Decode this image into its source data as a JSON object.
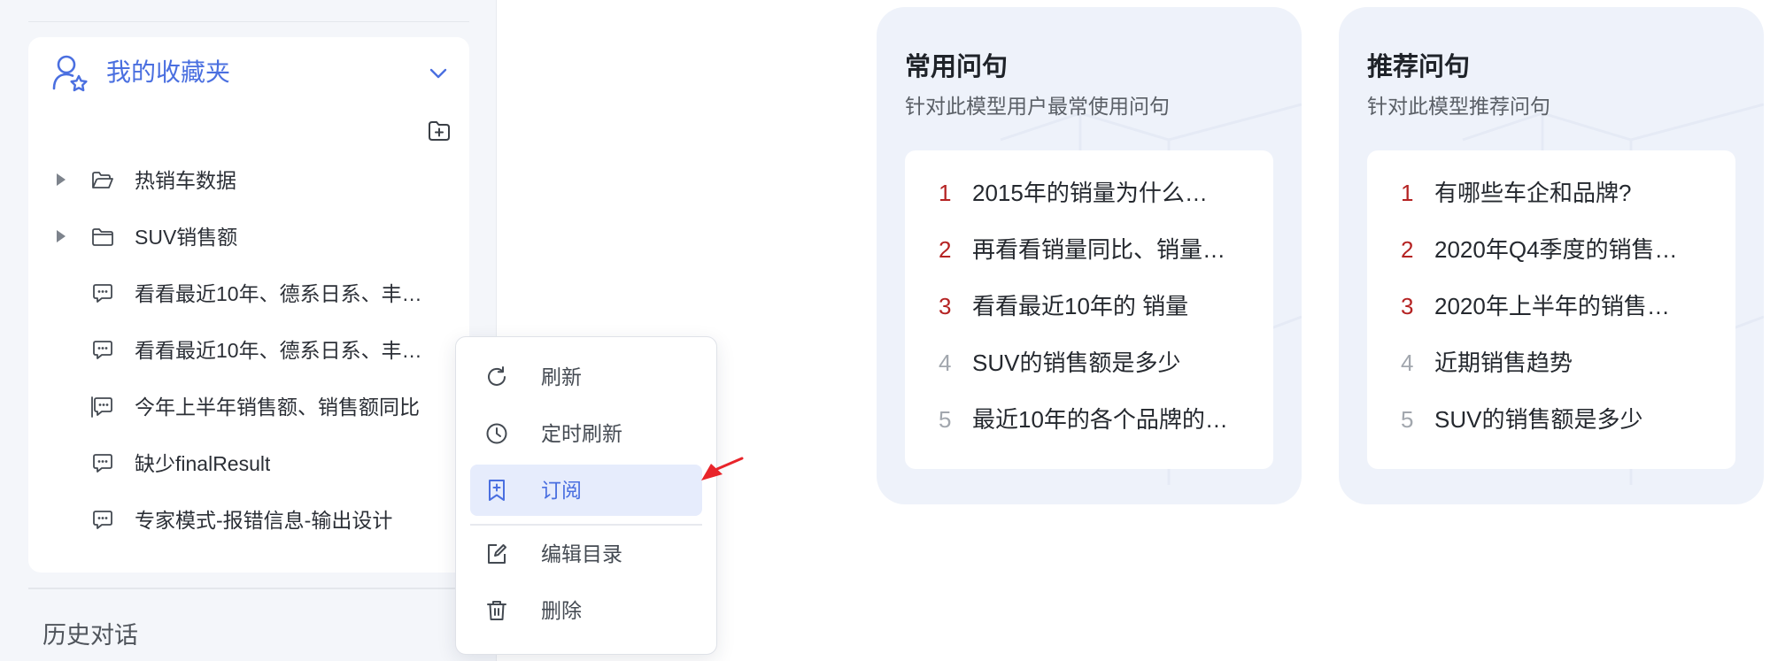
{
  "sidebar": {
    "favorites": {
      "title": "我的收藏夹",
      "items": [
        {
          "label": "热销车数据",
          "type": "folder",
          "expandable": true
        },
        {
          "label": "SUV销售额",
          "type": "folder",
          "expandable": true
        },
        {
          "label": "看看最近10年、德系日系、丰…",
          "type": "chat"
        },
        {
          "label": "看看最近10年、德系日系、丰…",
          "type": "chat"
        },
        {
          "label": "今年上半年销售额、销售额同比",
          "type": "chat"
        },
        {
          "label": "缺少finalResult",
          "type": "chat"
        },
        {
          "label": "专家模式-报错信息-输出设计",
          "type": "chat"
        }
      ]
    },
    "history_title": "历史对话"
  },
  "context_menu": {
    "items": [
      {
        "label": "刷新",
        "icon": "refresh-icon"
      },
      {
        "label": "定时刷新",
        "icon": "clock-icon"
      },
      {
        "label": "订阅",
        "icon": "bookmark-add-icon",
        "active": true
      },
      {
        "label": "编辑目录",
        "icon": "edit-icon"
      },
      {
        "label": "删除",
        "icon": "trash-icon"
      }
    ]
  },
  "common_questions": {
    "title": "常用问句",
    "subtitle": "针对此模型用户最常使用问句",
    "items": [
      {
        "num": "1",
        "text": "2015年的销量为什么…"
      },
      {
        "num": "2",
        "text": "再看看销量同比、销量…"
      },
      {
        "num": "3",
        "text": "看看最近10年的 销量"
      },
      {
        "num": "4",
        "text": "SUV的销售额是多少"
      },
      {
        "num": "5",
        "text": "最近10年的各个品牌的…"
      }
    ]
  },
  "recommended_questions": {
    "title": "推荐问句",
    "subtitle": "针对此模型推荐问句",
    "items": [
      {
        "num": "1",
        "text": "有哪些车企和品牌?"
      },
      {
        "num": "2",
        "text": "2020年Q4季度的销售…"
      },
      {
        "num": "3",
        "text": "2020年上半年的销售…"
      },
      {
        "num": "4",
        "text": "近期销售趋势"
      },
      {
        "num": "5",
        "text": "SUV的销售额是多少"
      }
    ]
  },
  "colors": {
    "accent": "#4a6fe0",
    "rank_hot": "#b52323",
    "rank_cold": "#a2a7ae",
    "annotation_arrow": "#e8242a"
  }
}
